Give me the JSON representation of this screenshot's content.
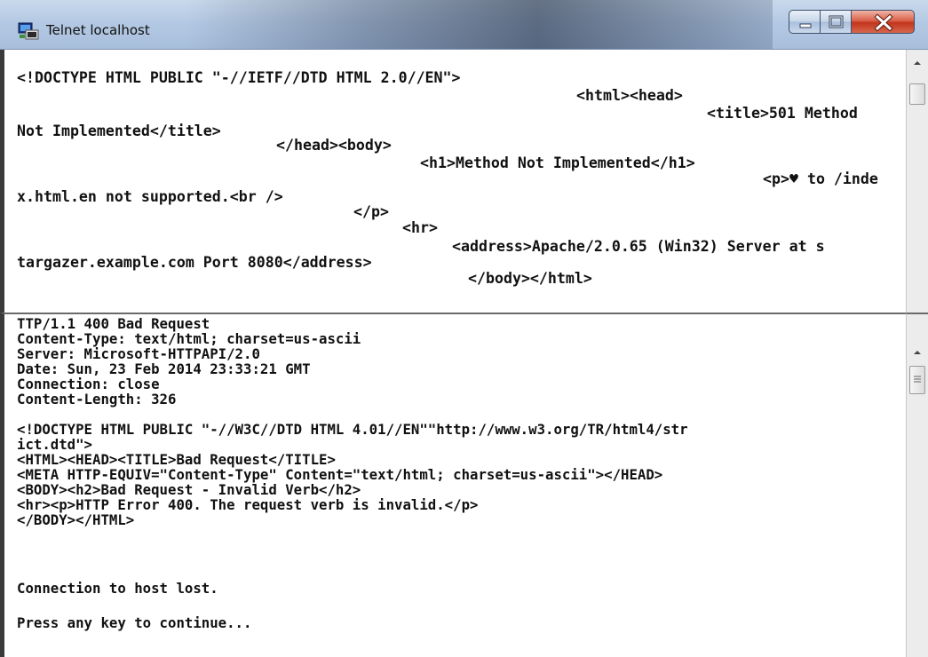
{
  "window": {
    "title": "Telnet localhost",
    "controls": {
      "minimize": "minimize",
      "maximize": "maximize",
      "close": "close"
    }
  },
  "top_terminal": {
    "lines": [
      "<!DOCTYPE HTML PUBLIC \"-//IETF//DTD HTML 2.0//EN\">",
      "<html><head>",
      "<title>501 Method",
      "Not Implemented</title>",
      "</head><body>",
      "<h1>Method Not Implemented</h1>",
      "<p>♥ to /inde",
      "x.html.en not supported.<br />",
      "</p>",
      "<hr>",
      "<address>Apache/2.0.65 (Win32) Server at s",
      "targazer.example.com Port 8080</address>",
      "</body></html>"
    ]
  },
  "bottom_terminal": {
    "lines": [
      "TTP/1.1 400 Bad Request",
      "Content-Type: text/html; charset=us-ascii",
      "Server: Microsoft-HTTPAPI/2.0",
      "Date: Sun, 23 Feb 2014 23:33:21 GMT",
      "Connection: close",
      "Content-Length: 326",
      "<!DOCTYPE HTML PUBLIC \"-//W3C//DTD HTML 4.01//EN\"\"http://www.w3.org/TR/html4/str",
      "ict.dtd\">",
      "<HTML><HEAD><TITLE>Bad Request</TITLE>",
      "<META HTTP-EQUIV=\"Content-Type\" Content=\"text/html; charset=us-ascii\"></HEAD>",
      "<BODY><h2>Bad Request - Invalid Verb</h2>",
      "<hr><p>HTTP Error 400. The request verb is invalid.</p>",
      "</BODY></HTML>",
      "Connection to host lost.",
      "Press any key to continue..."
    ]
  },
  "colors": {
    "terminal_bg": "#ffffff",
    "terminal_text": "#111111",
    "close_button": "#c2351b",
    "titlebar": "#b4c9e3"
  },
  "icons": [
    "telnet-app-icon",
    "minimize-icon",
    "maximize-icon",
    "close-icon",
    "scroll-up-arrow-icon",
    "scroll-thumb-grip-icon"
  ]
}
